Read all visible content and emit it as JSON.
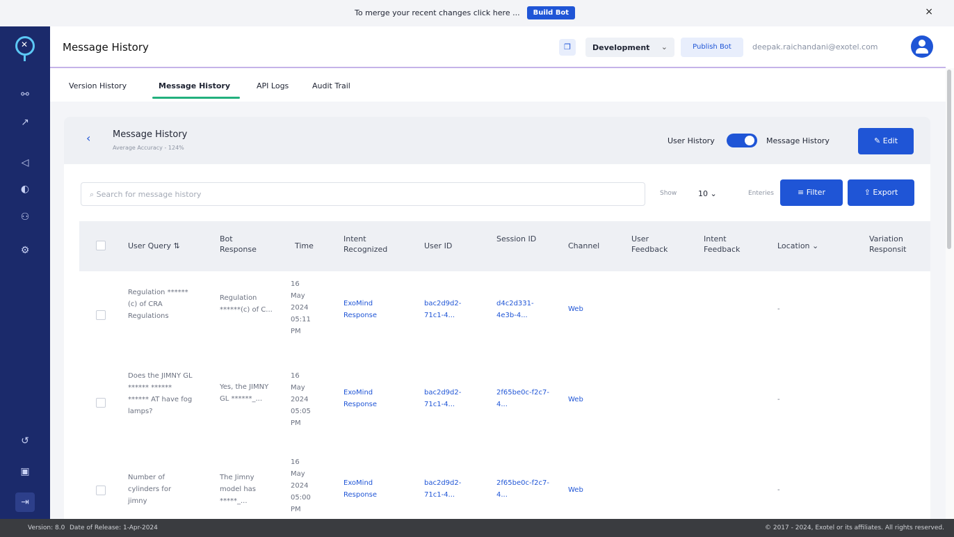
{
  "banner": {
    "text": "To merge your recent changes click here ...",
    "build_label": "Build Bot",
    "close_glyph": "×"
  },
  "sidebar": {
    "icons": [
      "flow-icon",
      "rocket-icon",
      "megaphone-icon",
      "palette-icon",
      "users-icon",
      "settings-icon",
      "history-icon",
      "document-icon",
      "exit-icon"
    ]
  },
  "header": {
    "title": "Message History",
    "environment": "Development",
    "publish_label": "Publish Bot",
    "user_email": "deepak.raichandani@exotel.com"
  },
  "tabs": [
    {
      "label": "Version History",
      "active": false
    },
    {
      "label": "Message History",
      "active": true
    },
    {
      "label": "API Logs",
      "active": false
    },
    {
      "label": "Audit Trail",
      "active": false
    }
  ],
  "card": {
    "title": "Message History",
    "subtitle": "Average Accuracy - 124%",
    "toggle_left": "User History",
    "toggle_right": "Message History",
    "toggle_on": true,
    "edit_label": "Edit"
  },
  "toolbar": {
    "search_placeholder": "Search for message history",
    "show_label": "Show",
    "entries_value": "10",
    "entries_label": "Enteries",
    "filter_label": "Filter",
    "export_label": "Export"
  },
  "table": {
    "headers": {
      "user_query": "User Query",
      "bot_response": "Bot Response",
      "time": "Time",
      "intent": "Intent Recognized",
      "user_id": "User ID",
      "session_id": "Session ID",
      "channel": "Channel",
      "user_feedback": "User Feedback",
      "intent_feedback": "Intent Feedback",
      "location": "Location",
      "variation": "Variation Responsit"
    },
    "rows": [
      {
        "query": "Regulation ******(c) of CRA Regulations",
        "response": "Regulation ******(c) of C...",
        "time": "16 May 2024 05:11 PM",
        "intent": "ExoMind Response",
        "user_id": "bac2d9d2-71c1-4...",
        "session_id": "d4c2d331-4e3b-4...",
        "channel": "Web",
        "location": "-"
      },
      {
        "query": "Does the JIMNY GL ****** ****** ****** AT have fog lamps?",
        "response": "Yes, the JIMNY GL ******_...",
        "time": "16 May 2024 05:05 PM",
        "intent": "ExoMind Response",
        "user_id": "bac2d9d2-71c1-4...",
        "session_id": "2f65be0c-f2c7-4...",
        "channel": "Web",
        "location": "-"
      },
      {
        "query": "Number of cylinders for jimny",
        "response": "The Jimny model has *****_...",
        "time": "16 May 2024 05:00 PM",
        "intent": "ExoMind Response",
        "user_id": "bac2d9d2-71c1-4...",
        "session_id": "2f65be0c-f2c7-4...",
        "channel": "Web",
        "location": "-"
      }
    ]
  },
  "footer": {
    "version": "Version: 8.0",
    "release": "Date of Release: 1-Apr-2024",
    "copyright": "© 2017 - 2024, Exotel or its affiliates. All rights reserved."
  },
  "colors": {
    "sidebar": "#1b2a6b",
    "primary": "#1f55d6",
    "tab_underline": "#22b07d",
    "footer": "#3a3c40"
  }
}
